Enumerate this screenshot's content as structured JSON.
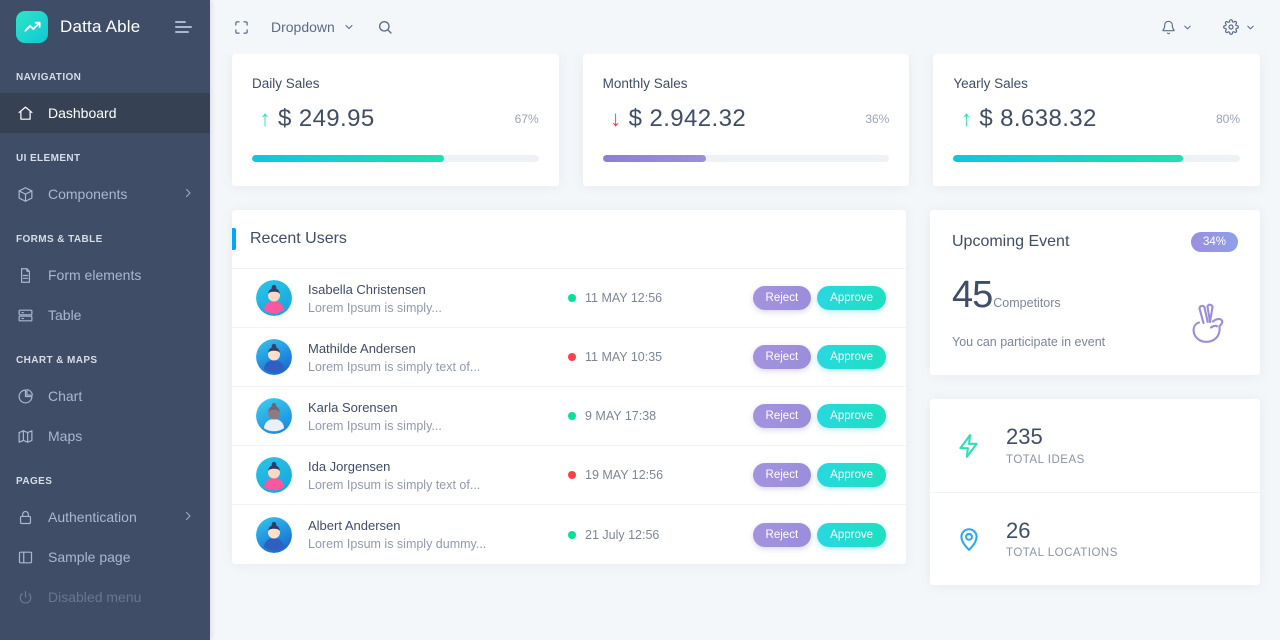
{
  "brand": {
    "name": "Datta Able",
    "logo_icon": "trending-up-icon",
    "menu_icon": "hamburger-icon"
  },
  "sidebar": {
    "sections": [
      {
        "caption": "NAVIGATION",
        "items": [
          {
            "label": "Dashboard",
            "icon": "home-icon",
            "active": true,
            "chevron": false,
            "disabled": false
          }
        ]
      },
      {
        "caption": "UI ELEMENT",
        "items": [
          {
            "label": "Components",
            "icon": "cube-icon",
            "active": false,
            "chevron": true,
            "disabled": false
          }
        ]
      },
      {
        "caption": "FORMS & TABLE",
        "items": [
          {
            "label": "Form elements",
            "icon": "document-icon",
            "active": false,
            "chevron": false,
            "disabled": false
          },
          {
            "label": "Table",
            "icon": "table-icon",
            "active": false,
            "chevron": false,
            "disabled": false
          }
        ]
      },
      {
        "caption": "CHART & MAPS",
        "items": [
          {
            "label": "Chart",
            "icon": "pie-chart-icon",
            "active": false,
            "chevron": false,
            "disabled": false
          },
          {
            "label": "Maps",
            "icon": "map-icon",
            "active": false,
            "chevron": false,
            "disabled": false
          }
        ]
      },
      {
        "caption": "PAGES",
        "items": [
          {
            "label": "Authentication",
            "icon": "lock-icon",
            "active": false,
            "chevron": true,
            "disabled": false
          },
          {
            "label": "Sample page",
            "icon": "sidebar-layout-icon",
            "active": false,
            "chevron": false,
            "disabled": false
          },
          {
            "label": "Disabled menu",
            "icon": "power-icon",
            "active": false,
            "chevron": false,
            "disabled": true
          }
        ]
      }
    ]
  },
  "topbar": {
    "fullscreen_icon": "fullscreen-icon",
    "dropdown_label": "Dropdown",
    "dropdown_chevron": "chevron-down-icon",
    "search_icon": "search-icon",
    "notification_icon": "bell-icon",
    "settings_icon": "gear-icon"
  },
  "stats": [
    {
      "title": "Daily Sales",
      "direction": "up",
      "arrow": "arrow-up-icon",
      "amount": "$ 249.95",
      "percent": "67%",
      "progress": 67,
      "bar_style": "teal"
    },
    {
      "title": "Monthly Sales",
      "direction": "down",
      "arrow": "arrow-down-icon",
      "amount": "$ 2.942.32",
      "percent": "36%",
      "progress": 36,
      "bar_style": "purple"
    },
    {
      "title": "Yearly Sales",
      "direction": "up",
      "arrow": "arrow-up-icon",
      "amount": "$ 8.638.32",
      "percent": "80%",
      "progress": 80,
      "bar_style": "teal"
    }
  ],
  "recent_users": {
    "title": "Recent Users",
    "reject_label": "Reject",
    "approve_label": "Approve",
    "rows": [
      {
        "name": "Isabella Christensen",
        "note": "Lorem Ipsum is simply...",
        "time": "11 MAY 12:56",
        "status": "green",
        "avatar": "avatar-female-pink"
      },
      {
        "name": "Mathilde Andersen",
        "note": "Lorem Ipsum is simply text of...",
        "time": "11 MAY 10:35",
        "status": "red",
        "avatar": "avatar-male-blue"
      },
      {
        "name": "Karla Sorensen",
        "note": "Lorem Ipsum is simply...",
        "time": "9 MAY 17:38",
        "status": "green",
        "avatar": "avatar-female-grey"
      },
      {
        "name": "Ida Jorgensen",
        "note": "Lorem Ipsum is simply text of...",
        "time": "19 MAY 12:56",
        "status": "red",
        "avatar": "avatar-female-pink2"
      },
      {
        "name": "Albert Andersen",
        "note": "Lorem Ipsum is simply dummy...",
        "time": "21 July 12:56",
        "status": "green",
        "avatar": "avatar-male-blue2"
      }
    ]
  },
  "event": {
    "title": "Upcoming Event",
    "badge": "34%",
    "count": "45",
    "count_unit": "Competitors",
    "note": "You can participate in event",
    "icon": "peace-hand-icon"
  },
  "mini_stats": [
    {
      "value": "235",
      "label": "TOTAL IDEAS",
      "icon": "lightning-bolt-icon",
      "color": "#2ce0b6"
    },
    {
      "value": "26",
      "label": "TOTAL LOCATIONS",
      "icon": "map-pin-icon",
      "color": "#2ca8f2"
    }
  ],
  "colors": {
    "sidebar_bg": "#3f4d67",
    "page_bg": "#f4f7fa",
    "accent_blue": "#00a8f2",
    "accent_teal": "#1ee0b0",
    "accent_purple": "#9b8ddb",
    "status_green": "#00e396",
    "status_red": "#ff4045",
    "text_dark": "#3f4d67"
  }
}
